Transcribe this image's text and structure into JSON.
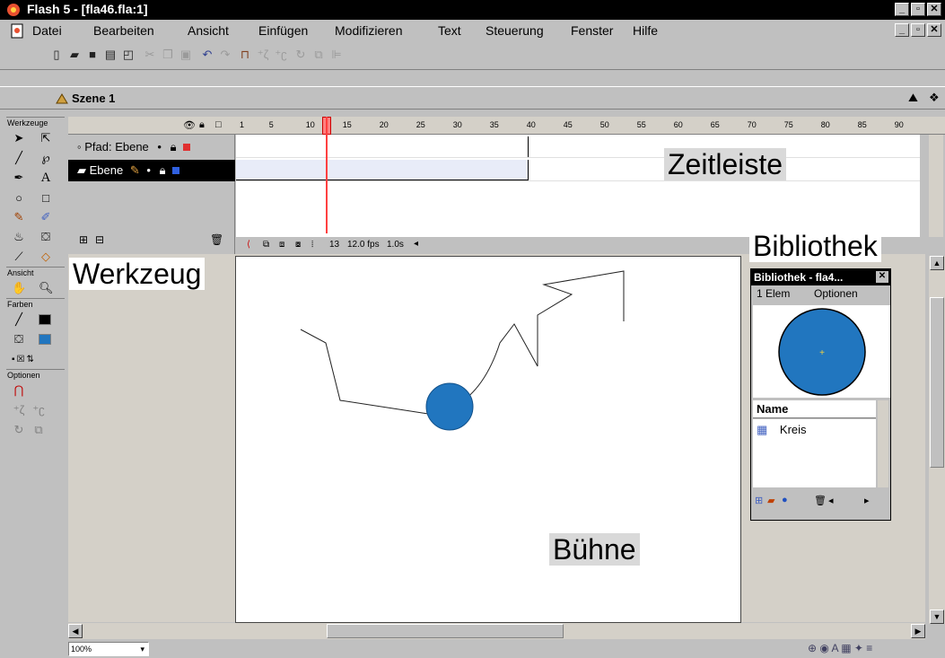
{
  "window": {
    "title": "Flash 5 - [fla46.fla:1]"
  },
  "menus": [
    "Datei",
    "Bearbeiten",
    "Ansicht",
    "Einfügen",
    "Modifizieren",
    "Text",
    "Steuerung",
    "Fenster",
    "Hilfe"
  ],
  "scene": {
    "label": "Szene 1"
  },
  "tools": {
    "header": "Werkzeuge",
    "view_header": "Ansicht",
    "colors_header": "Farben",
    "options_header": "Optionen"
  },
  "timeline": {
    "ruler": [
      "1",
      "5",
      "10",
      "15",
      "20",
      "25",
      "30",
      "35",
      "40",
      "45",
      "50",
      "55",
      "60",
      "65",
      "70",
      "75",
      "80",
      "85",
      "90"
    ],
    "current_frame": "13",
    "frame_rate": "12.0 fps",
    "elapsed": "1.0s",
    "layers": [
      {
        "name": "Pfad: Ebene",
        "selected": false,
        "color": "#e03030"
      },
      {
        "name": "Ebene",
        "selected": true,
        "color": "#3060e0"
      }
    ]
  },
  "library": {
    "title": "Bibliothek - fla4...",
    "item_count": "1 Elem",
    "options": "Optionen",
    "column_name": "Name",
    "items": [
      {
        "name": "Kreis"
      }
    ],
    "symbol_color": "#2176bf"
  },
  "stage": {
    "circle_color": "#2176bf"
  },
  "status": {
    "zoom": "100%"
  },
  "annotations": {
    "timeline": "Zeitleiste",
    "tools": "Werkzeug",
    "library": "Bibliothek",
    "stage": "Bühne"
  }
}
